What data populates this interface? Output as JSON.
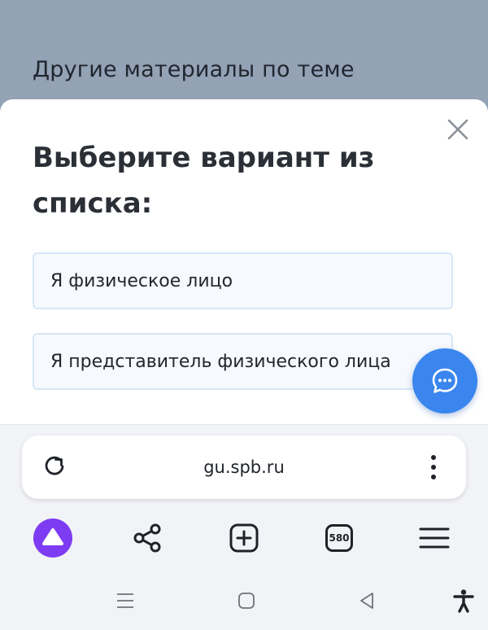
{
  "page": {
    "background_title": "Другие материалы по теме"
  },
  "dialog": {
    "title": "Выберите вариант из списка:",
    "options": [
      {
        "label": "Я физическое лицо"
      },
      {
        "label": "Я представитель физического лица"
      }
    ],
    "close_icon": "close-icon",
    "chat_icon": "chat-bubble-icon"
  },
  "browser": {
    "url": "gu.spb.ru",
    "tabs_count": "580",
    "icons": [
      "reload-icon",
      "more-vertical-icon",
      "alice-assistant-icon",
      "share-icon",
      "new-tab-icon",
      "tabs-counter-icon",
      "menu-icon"
    ]
  },
  "system_nav": {
    "icons": [
      "recents-icon",
      "home-icon",
      "back-icon",
      "accessibility-icon"
    ]
  },
  "colors": {
    "backdrop": "#94a2b6",
    "accent": "#3a86ee",
    "alice": "#7d3cf2",
    "option_border": "#d6e7f7"
  }
}
